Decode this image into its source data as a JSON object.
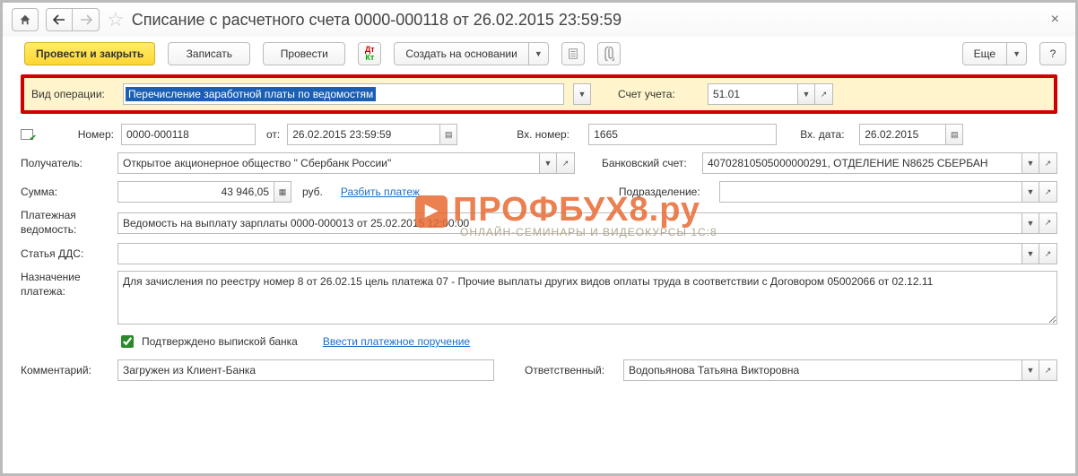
{
  "header": {
    "title": "Списание с расчетного счета 0000-000118 от 26.02.2015 23:59:59"
  },
  "toolbar": {
    "submit_close": "Провести и закрыть",
    "save": "Записать",
    "submit": "Провести",
    "create_based": "Создать на основании",
    "more": "Еще",
    "help": "?"
  },
  "form": {
    "op_label": "Вид операции:",
    "op_value": "Перечисление заработной платы по ведомостям",
    "acct_label": "Счет учета:",
    "acct_value": "51.01",
    "num_label": "Номер:",
    "num_value": "0000-000118",
    "from_label": "от:",
    "from_value": "26.02.2015 23:59:59",
    "in_num_label": "Вх. номер:",
    "in_num_value": "1665",
    "in_date_label": "Вх. дата:",
    "in_date_value": "26.02.2015",
    "recipient_label": "Получатель:",
    "recipient_value": "Открытое акционерное общество \" Сбербанк России\"",
    "bank_acct_label": "Банковский счет:",
    "bank_acct_value": "40702810505000000291, ОТДЕЛЕНИЕ N8625 СБЕРБАН",
    "sum_label": "Сумма:",
    "sum_value": "43 946,05",
    "sum_unit": "руб.",
    "split_link": "Разбить платеж",
    "dept_label": "Подразделение:",
    "dept_value": "",
    "payroll_label1": "Платежная",
    "payroll_label2": "ведомость:",
    "payroll_value": "Ведомость на выплату зарплаты 0000-000013 от 25.02.2015 12:00:00",
    "dds_label": "Статья ДДС:",
    "dds_value": "",
    "purpose_label1": "Назначение",
    "purpose_label2": "платежа:",
    "purpose_value": "Для зачисления по реестру номер 8 от 26.02.15 цель платежа 07 - Прочие выплаты других видов оплаты труда в соответствии с Договором 05002066 от 02.12.11",
    "confirmed_label": "Подтверждено выпиской банка",
    "enter_order_link": "Ввести платежное поручение",
    "comment_label": "Комментарий:",
    "comment_value": "Загружен из Клиент-Банка",
    "responsible_label": "Ответственный:",
    "responsible_value": "Водопьянова Татьяна Викторовна"
  },
  "watermark": {
    "main": "ПРОФБУХ8.ру",
    "sub": "ОНЛАЙН-СЕМИНАРЫ И ВИДЕОКУРСЫ 1С:8"
  }
}
